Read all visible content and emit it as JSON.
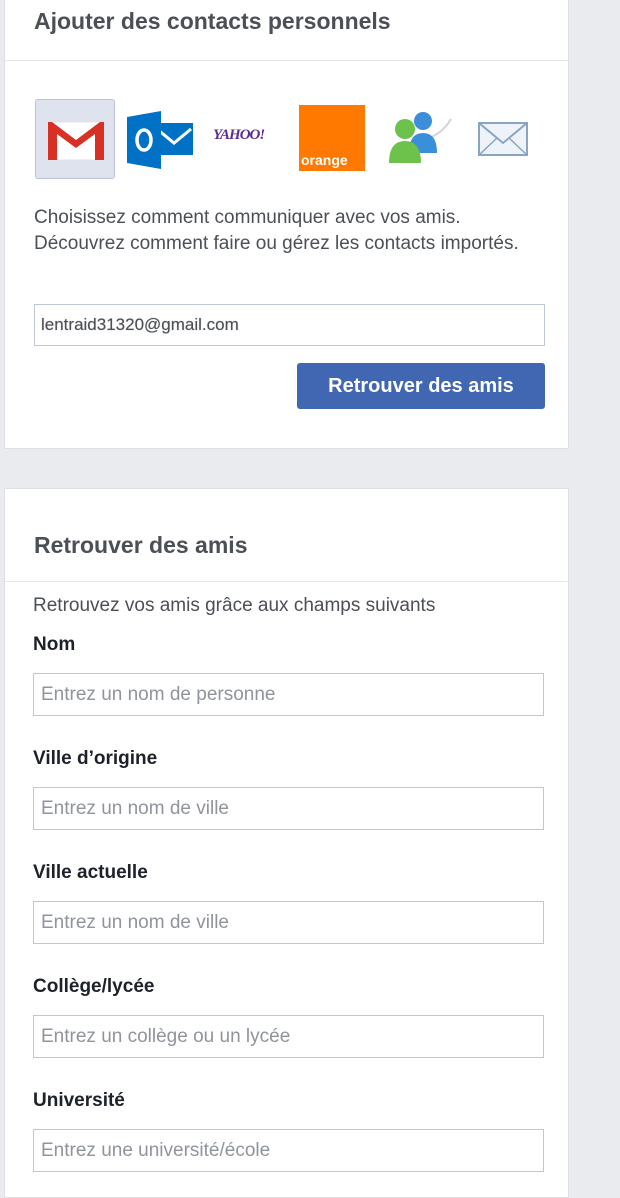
{
  "contacts_card": {
    "title": "Ajouter des contacts personnels",
    "providers": [
      {
        "name": "Gmail",
        "icon": "gmail-icon",
        "selected": true
      },
      {
        "name": "Outlook",
        "icon": "outlook-icon",
        "selected": false
      },
      {
        "name": "Yahoo",
        "icon": "yahoo-icon",
        "label": "YAHOO!",
        "selected": false
      },
      {
        "name": "Orange",
        "icon": "orange-icon",
        "label": "orange",
        "selected": false
      },
      {
        "name": "Windows Live Messenger",
        "icon": "messenger-icon",
        "selected": false
      },
      {
        "name": "Email",
        "icon": "envelope-icon",
        "selected": false
      }
    ],
    "description_before": "Choisissez comment communiquer avec vos amis. ",
    "description_link1": "Découvrez comment faire",
    "description_middle": " ou ",
    "description_link2": "gérez les contacts importés",
    "description_end": ".",
    "email_value": "lentraid31320@gmail.com",
    "button_label": "Retrouver des amis"
  },
  "search_card": {
    "title": "Retrouver des amis",
    "subtitle": "Retrouvez vos amis grâce aux champs suivants",
    "fields": {
      "nom": {
        "label": "Nom",
        "placeholder": "Entrez un nom de personne"
      },
      "ville_origine": {
        "label": "Ville d’origine",
        "placeholder": "Entrez un nom de ville"
      },
      "ville_actuelle": {
        "label": "Ville actuelle",
        "placeholder": "Entrez un nom de ville"
      },
      "college": {
        "label": "Collège/lycée",
        "placeholder": "Entrez un collège ou un lycée"
      },
      "universite": {
        "label": "Université",
        "placeholder": "Entrez une université/école"
      }
    }
  },
  "colors": {
    "page_background": "#e9ebee",
    "primary_button": "#4267b2",
    "orange_brand": "#ff7900",
    "gmail_red": "#d93025",
    "outlook_blue": "#0072c6"
  }
}
